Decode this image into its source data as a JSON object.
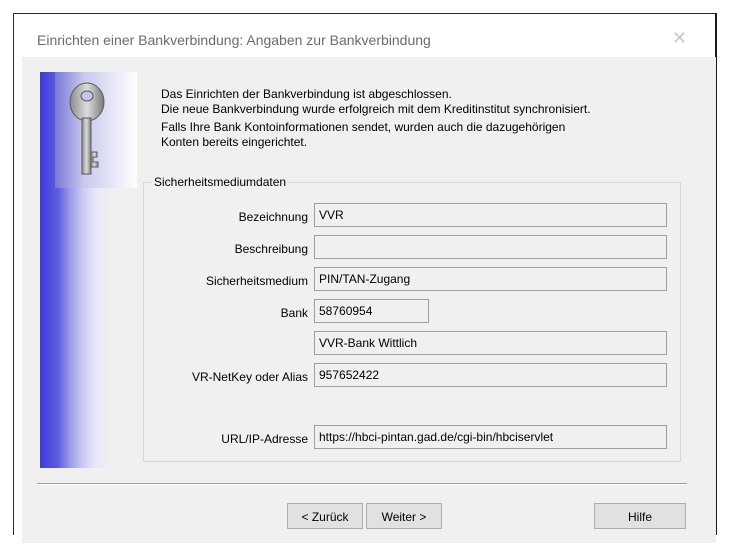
{
  "window": {
    "title": "Einrichten einer Bankverbindung: Angaben zur Bankverbindung",
    "close_glyph": "✕"
  },
  "intro": {
    "line1": "Das Einrichten der Bankverbindung ist abgeschlossen.",
    "line2": "Die neue Bankverbindung wurde erfolgreich mit dem Kreditinstitut synchronisiert.",
    "line3": "Falls Ihre Bank Kontoinformationen sendet, wurden auch die dazugehörigen",
    "line4": "Konten bereits eingerichtet."
  },
  "group": {
    "legend": "Sicherheitsmediumdaten",
    "fields": {
      "bezeichnung": {
        "label": "Bezeichnung",
        "value": "VVR"
      },
      "beschreibung": {
        "label": "Beschreibung",
        "value": ""
      },
      "sicherheitsmedium": {
        "label": "Sicherheitsmedium",
        "value": "PIN/TAN-Zugang"
      },
      "bank": {
        "label": "Bank",
        "value": "58760954",
        "name": "VVR-Bank Wittlich"
      },
      "netkey": {
        "label": "VR-NetKey oder Alias",
        "value": "957652422"
      },
      "url": {
        "label": "URL/IP-Adresse",
        "value": "https://hbci-pintan.gad.de/cgi-bin/hbciservlet"
      }
    }
  },
  "buttons": {
    "back": "< Zurück",
    "next": "Weiter >",
    "help": "Hilfe"
  },
  "colors": {
    "sidebar_accent": "#3b3bd9",
    "dialog_bg": "#f0f0f0"
  },
  "icons": {
    "key": "key-icon"
  }
}
